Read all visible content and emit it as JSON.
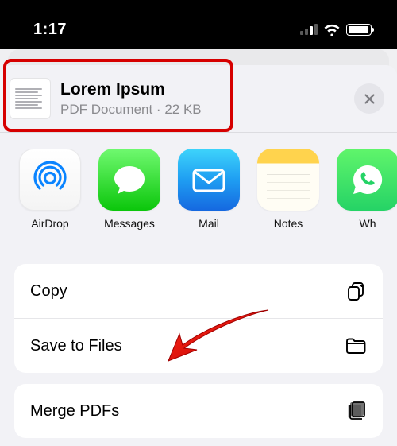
{
  "status": {
    "time": "1:17"
  },
  "file": {
    "title": "Lorem Ipsum",
    "type": "PDF Document",
    "separator": " · ",
    "size": "22 KB"
  },
  "share_apps": [
    {
      "label": "AirDrop"
    },
    {
      "label": "Messages"
    },
    {
      "label": "Mail"
    },
    {
      "label": "Notes"
    },
    {
      "label": "Wh"
    }
  ],
  "actions": {
    "group1": [
      {
        "label": "Copy"
      },
      {
        "label": "Save to Files"
      }
    ],
    "group2": [
      {
        "label": "Merge PDFs"
      }
    ]
  }
}
